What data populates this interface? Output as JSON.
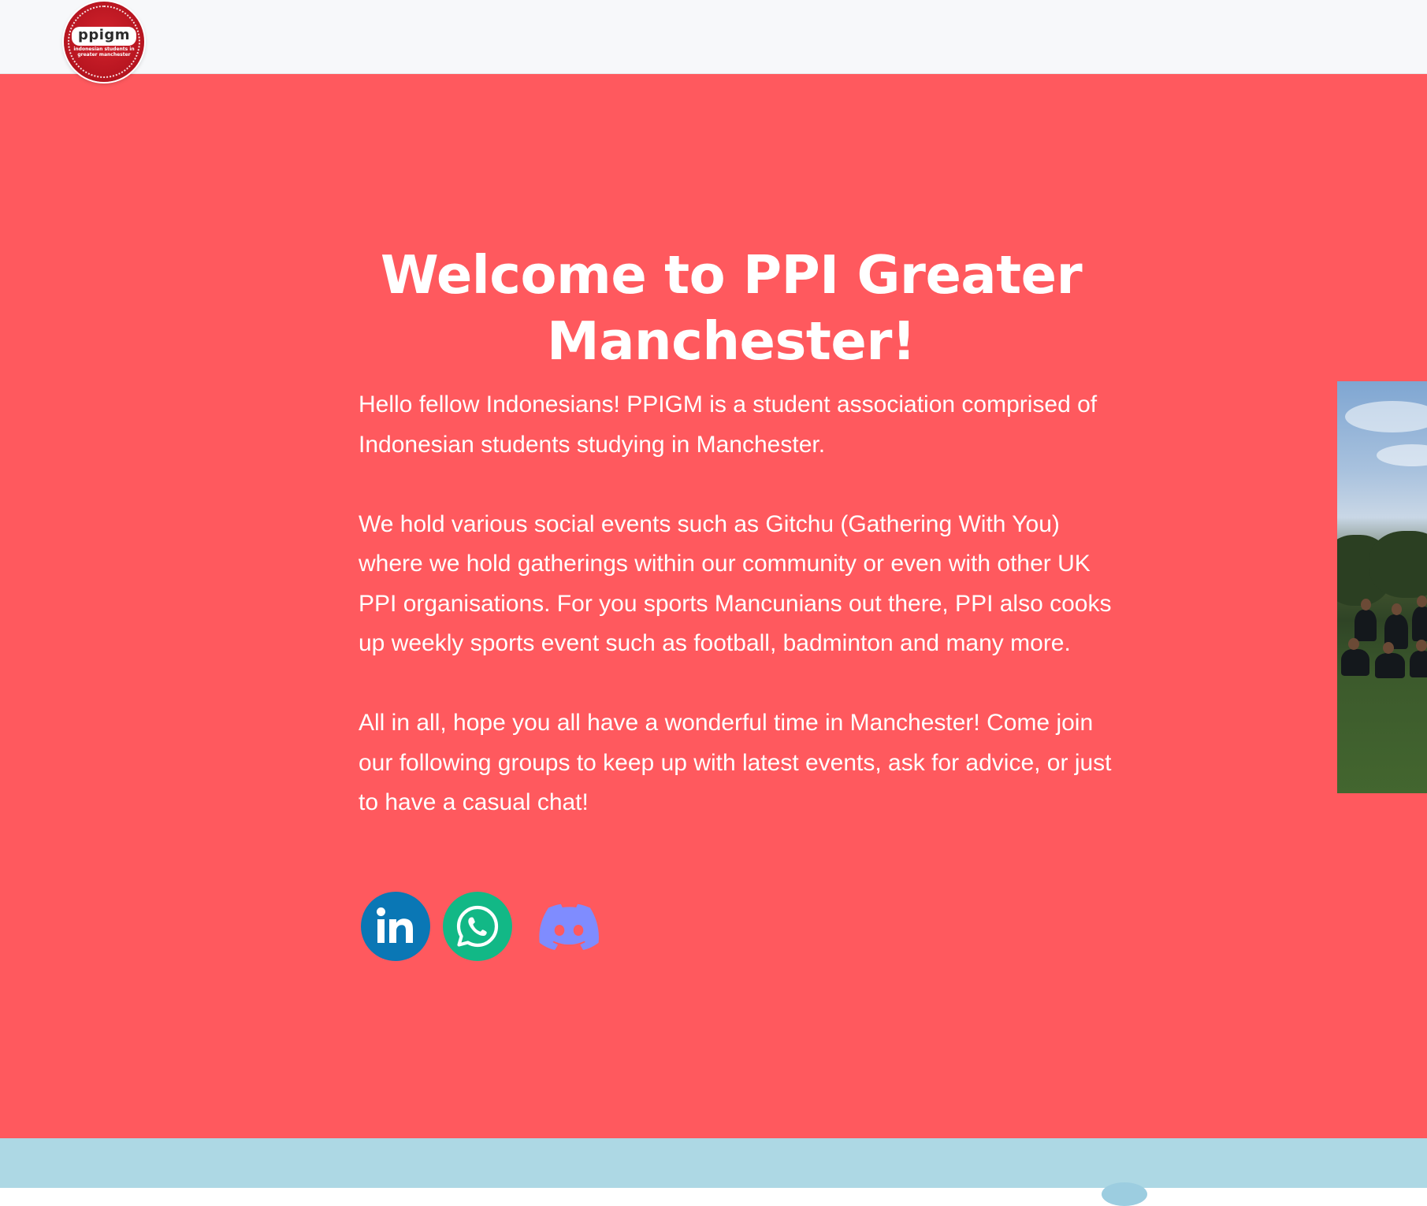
{
  "navbar": {
    "logo": {
      "wordmark": "ppigm",
      "tagline": "indonesian students in greater manchester",
      "icon": "ppigm-logo"
    }
  },
  "hero": {
    "title": "Welcome to PPI Greater Manchester!",
    "paragraphs": [
      "Hello fellow Indonesians! PPIGM is a student association comprised of Indonesian students studying in Manchester.",
      "We hold various social events such as Gitchu (Gathering With You) where we hold gatherings within our community or even with other UK PPI organisations. For you sports Mancunians out there, PPI also cooks up weekly sports event such as football, badminton and many more.",
      "All in all, hope you all have a wonderful time in Manchester! Come join our following groups to keep up with latest events, ask for advice, or just to have a casual chat!"
    ],
    "socials": [
      {
        "icon": "linkedin-icon",
        "color": "#0a77b5"
      },
      {
        "icon": "whatsapp-icon",
        "color": "#12b886"
      },
      {
        "icon": "discord-icon",
        "color": "#7f8cff"
      }
    ]
  },
  "colors": {
    "hero_background": "#ff595e",
    "navbar_background": "#f7f8fa",
    "bottom_band": "#add8e4",
    "text": "#ffffff"
  }
}
